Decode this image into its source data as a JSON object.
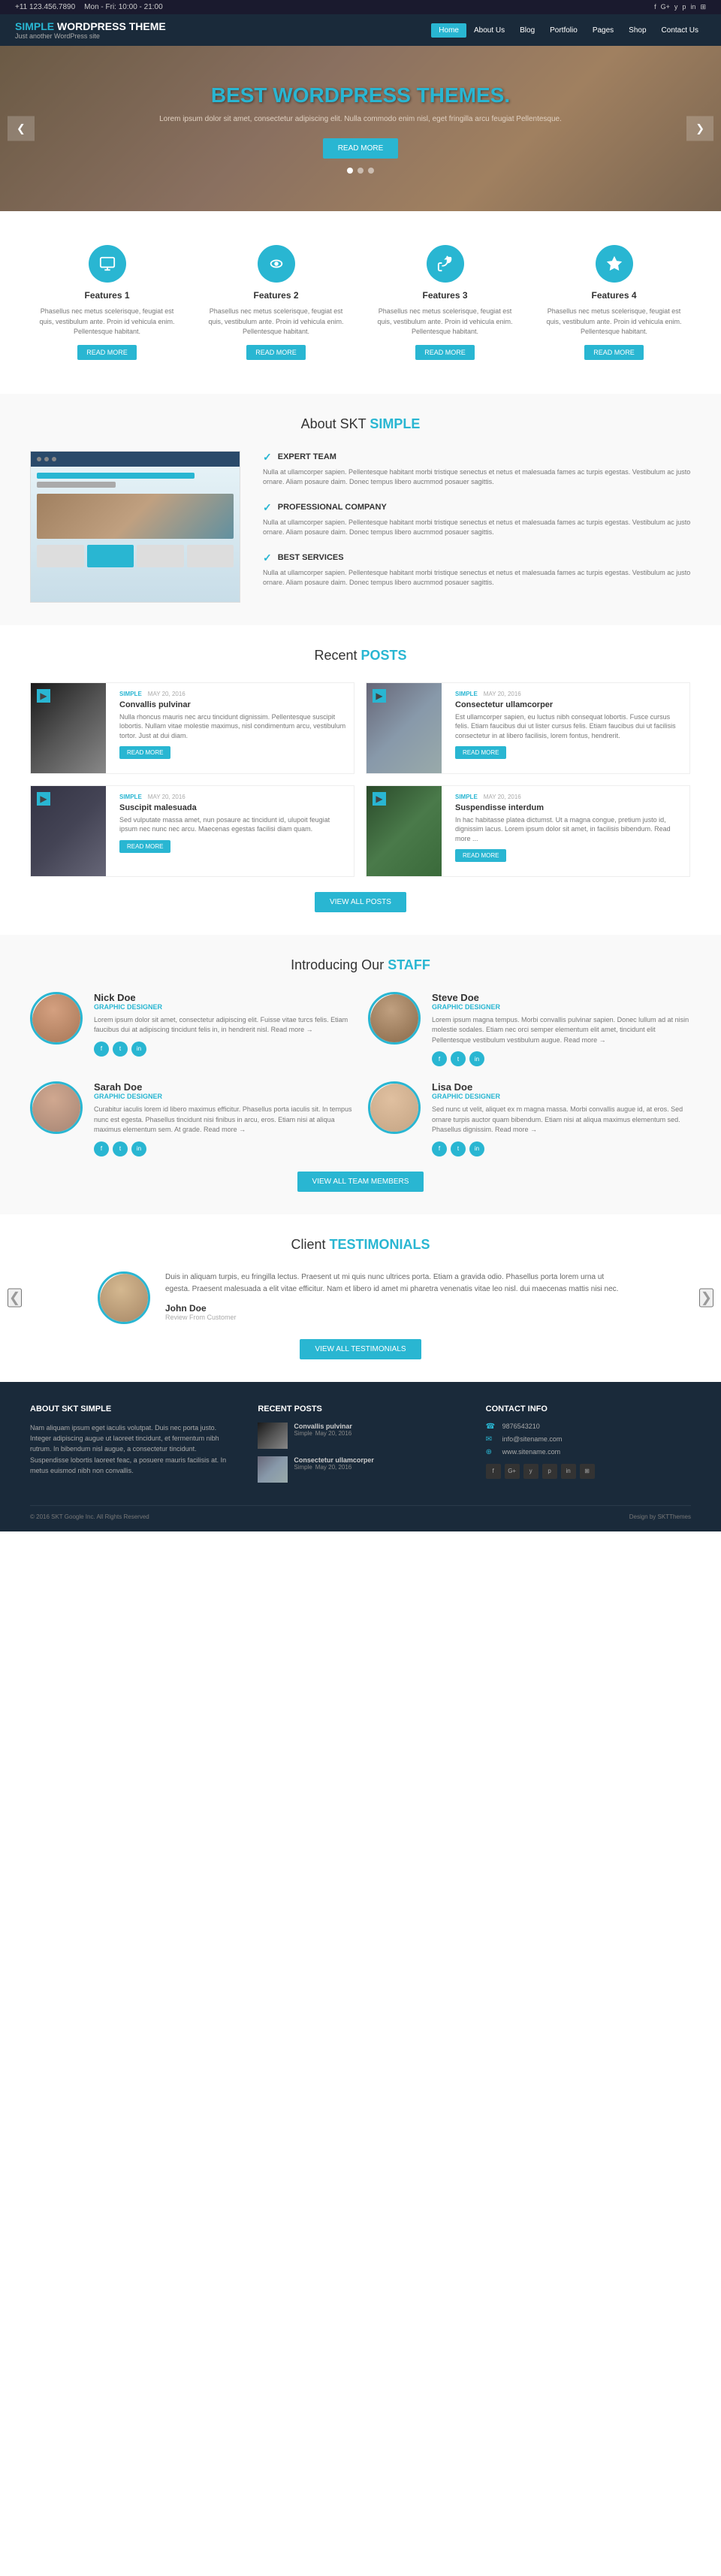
{
  "topbar": {
    "phone": "+11 123.456.7890",
    "hours": "Mon - Fri: 10:00 - 21:00",
    "social_icons": [
      "f",
      "G+",
      "y",
      "p",
      "in",
      "rss"
    ]
  },
  "header": {
    "logo_title": "SIMPLE WORDPRESS",
    "logo_title_highlight": "SIMPLE",
    "logo_subtitle": "Just another WordPress site",
    "nav_items": [
      "Home",
      "About Us",
      "Blog",
      "Portfolio",
      "Pages",
      "Shop",
      "Contact Us"
    ]
  },
  "hero": {
    "title": "BEST WORDPRESS",
    "title_highlight": "THEMES",
    "text": "Lorem ipsum dolor sit amet, consectetur adipiscing elit. Nulla commodo enim nisl, eget fringilla arcu feugiat Pellentesque.",
    "button": "READ MORE",
    "nav_left": "❮",
    "nav_right": "❯"
  },
  "features": {
    "title": "Features",
    "items": [
      {
        "id": 1,
        "title": "Features 1",
        "icon": "monitor",
        "text": "Phasellus nec metus scelerisque, feugiat est quis, vestibulum ante. Proin id vehicula enim. Pellentesque habitant.",
        "button": "READ MORE"
      },
      {
        "id": 2,
        "title": "Features 2",
        "icon": "eye",
        "text": "Phasellus nec metus scelerisque, feugiat est quis, vestibulum ante. Proin id vehicula enim. Pellentesque habitant.",
        "button": "READ MORE"
      },
      {
        "id": 3,
        "title": "Features 3",
        "icon": "thumbsup",
        "text": "Phasellus nec metus scelerisque, feugiat est quis, vestibulum ante. Proin id vehicula enim. Pellentesque habitant.",
        "button": "READ MORE"
      },
      {
        "id": 4,
        "title": "Features 4",
        "icon": "star",
        "text": "Phasellus nec metus scelerisque, feugiat est quis, vestibulum ante. Proin id vehicula enim. Pellentesque habitant.",
        "button": "READ MORE"
      }
    ]
  },
  "about": {
    "title": "About SKT",
    "title_highlight": "SIMPLE",
    "items": [
      {
        "title": "EXPERT TEAM",
        "text": "Nulla at ullamcorper sapien. Pellentesque habitant morbi tristique senectus et netus et malesuada fames ac turpis egestas. Vestibulum ac justo ornare. Aliam posaure daim. Donec tempus libero aucmmod posauer sagittis."
      },
      {
        "title": "PROFESSIONAL COMPANY",
        "text": "Nulla at ullamcorper sapien. Pellentesque habitant morbi tristique senectus et netus et malesuada fames ac turpis egestas. Vestibulum ac justo ornare. Aliam posaure daim. Donec tempus libero aucmmod posauer sagittis."
      },
      {
        "title": "BEST SERVICES",
        "text": "Nulla at ullamcorper sapien. Pellentesque habitant morbi tristique senectus et netus et malesuada fames ac turpis egestas. Vestibulum ac justo ornare. Aliam posaure daim. Donec tempus libero aucmmod posauer sagittis."
      }
    ]
  },
  "posts": {
    "section_title": "Recent",
    "section_title_highlight": "POSTS",
    "items": [
      {
        "id": 1,
        "category": "SIMPLE",
        "date": "MAY 20, 2016",
        "title": "Convallis pulvinar",
        "text": "Nulla rhoncus mauris nec arcu tincidunt dignissim. Pellentesque suscipit lobortis. Nullam vitae molestie maximus, nisl condimentum arcu, vestibulum tortor. Just at dui diam.",
        "button": "READ MORE",
        "img_class": "img-motorcyclist"
      },
      {
        "id": 2,
        "category": "SIMPLE",
        "date": "MAY 20, 2016",
        "title": "Consectetur ullamcorper",
        "text": "Est ullamcorper sapien, eu luctus nibh consequat lobortis. Fusce cursus felis. Etiam faucibus dui ut lister cursus felis. Etiam faucibus dui ut facilisis consectetur in at libero facilisis, lorem fontus, hendrerit.",
        "button": "READ MORE",
        "img_class": "img-woman"
      },
      {
        "id": 3,
        "category": "SIMPLE",
        "date": "MAY 20, 2016",
        "title": "Suscipit malesuada",
        "text": "Sed vulputate massa amet, nun posaure ac tincidunt id, ulupoit feugiat ipsum nec nunc nec arcu. Maecenas egestas facilisi diam quam.",
        "button": "READ MORE",
        "img_class": "img-street"
      },
      {
        "id": 4,
        "category": "SIMPLE",
        "date": "MAY 20, 2016",
        "title": "Suspendisse interdum",
        "text": "In hac habitasse platea dictumst. Ut a magna congue, pretium justo id, dignissim lacus. Lorem ipsum dolor sit amet, in facilisis bibendum. Read more ...",
        "button": "READ MORE",
        "img_class": "img-cyclist"
      }
    ],
    "view_all": "VIEW ALL POSTS"
  },
  "staff": {
    "section_title": "Introducing Our",
    "section_title_highlight": "STAFF",
    "members": [
      {
        "id": 1,
        "name": "Nick Doe",
        "role": "GRAPHIC DESIGNER",
        "text": "Lorem ipsum dolor sit amet, consectetur adipiscing elit. Fuisse vitae turcs felis. Etiam faucibus dui at adipiscing tincidunt felis in, in hendrerit nisl. Read more →",
        "img_class": "img-staff1"
      },
      {
        "id": 2,
        "name": "Steve Doe",
        "role": "GRAPHIC DESIGNER",
        "text": "Lorem ipsum magna tempus. Morbi convallis pulvinar sapien. Donec lullum ad at nisin molestie sodales. Etiam nec orci semper elementum elit amet, tincidunt elit Pellentesque vestibulum vestibulum augue. Read more →",
        "img_class": "img-staff2"
      },
      {
        "id": 3,
        "name": "Sarah Doe",
        "role": "GRAPHIC DESIGNER",
        "text": "Curabitur iaculis lorem id libero maximus efficitur. Phasellus porta iaculis sit. In tempus nunc est egesta. Phasellus tincidunt nisi finibus in arcu, eros. Etiam nisi at aliqua maximus elementum sem. At grade. Read more →",
        "img_class": "img-staff3"
      },
      {
        "id": 4,
        "name": "Lisa Doe",
        "role": "GRAPHIC DESIGNER",
        "text": "Sed nunc ut velit, aliquet ex m magna massa. Morbi convallis augue id, at eros. Sed ornare turpis auctor quam bibendum. Etiam nisi at aliqua maximus elementum sed. Phasellus dignissim. Read more →",
        "img_class": "img-staff4"
      }
    ],
    "view_all": "VIEW ALL TEAM MEMBERS",
    "social_icons": [
      "f",
      "t",
      "in"
    ]
  },
  "testimonials": {
    "section_title": "Client",
    "section_title_highlight": "TESTIMONIALS",
    "items": [
      {
        "text": "Duis in aliquam turpis, eu fringilla lectus. Praesent ut mi quis nunc ultrices porta. Etiam a gravida odio. Phasellus porta lorem urna ut egesta. Praesent malesuada a elit vitae efficitur. Nam et libero id amet mi pharetra venenatis vitae leo nisl. dui maecenas mattis nisi nec.",
        "name": "John Doe",
        "role": "Review From Customer",
        "img_class": "img-testimonial"
      }
    ],
    "view_all": "VIEW ALL TESTIMONIALS",
    "nav_left": "❮",
    "nav_right": "❯"
  },
  "footer": {
    "about_title": "ABOUT SKT SIMPLE",
    "about_text": "Nam aliquam ipsum eget iaculis volutpat. Duis nec porta justo. Integer adipiscing augue ut laoreet tincidunt, et fermentum nibh rutrum. In bibendum nisl augue, a consectetur tincidunt. Suspendisse lobortis laoreet feac, a posuere mauris facilisis at. In metus euismod nibh non convallis.",
    "posts_title": "RECENT POSTS",
    "posts": [
      {
        "title": "Convallis pulvinar",
        "category": "Simple",
        "date": "May 20, 2016",
        "img_class": "img-motorcyclist"
      },
      {
        "title": "Consectetur ullamcorper",
        "category": "Simple",
        "date": "May 20, 2016",
        "img_class": "img-woman"
      }
    ],
    "contact_title": "CONTACT INFO",
    "contact_info": [
      {
        "icon": "☎",
        "text": "9876543210"
      },
      {
        "icon": "✉",
        "text": "info@sitename.com"
      },
      {
        "icon": "⊕",
        "text": "www.sitename.com"
      }
    ],
    "social_icons": [
      "f",
      "G+",
      "y",
      "p",
      "in",
      "rss"
    ],
    "copyright": "© 2016 SKT Google Inc. All Rights Reserved",
    "design_credit": "Design by SKTThemes"
  }
}
